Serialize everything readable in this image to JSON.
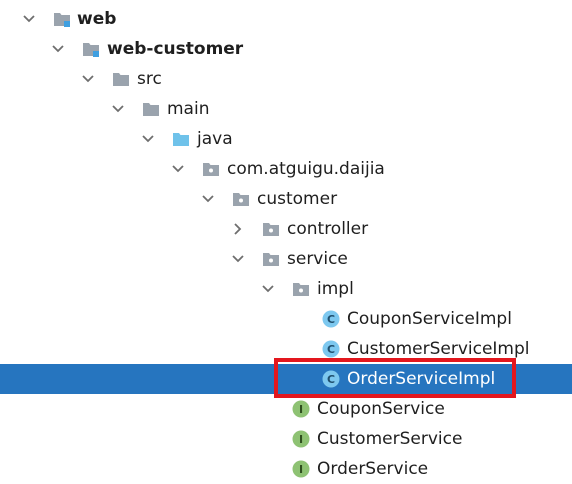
{
  "tree": {
    "nodes": [
      {
        "label": "web",
        "icon": "module-folder-icon",
        "expanded": true
      },
      {
        "label": "web-customer",
        "icon": "module-folder-icon",
        "expanded": true
      },
      {
        "label": "src",
        "icon": "folder-icon",
        "expanded": true
      },
      {
        "label": "main",
        "icon": "folder-icon",
        "expanded": true
      },
      {
        "label": "java",
        "icon": "source-root-folder-icon",
        "expanded": true
      },
      {
        "label": "com.atguigu.daijia",
        "icon": "package-icon",
        "expanded": true
      },
      {
        "label": "customer",
        "icon": "package-icon",
        "expanded": true
      },
      {
        "label": "controller",
        "icon": "package-icon",
        "expanded": false
      },
      {
        "label": "service",
        "icon": "package-icon",
        "expanded": true
      },
      {
        "label": "impl",
        "icon": "package-icon",
        "expanded": true
      },
      {
        "label": "CouponServiceImpl",
        "icon": "java-class-icon"
      },
      {
        "label": "CustomerServiceImpl",
        "icon": "java-class-icon"
      },
      {
        "label": "OrderServiceImpl",
        "icon": "java-class-icon",
        "selected": true
      },
      {
        "label": "CouponService",
        "icon": "java-interface-icon"
      },
      {
        "label": "CustomerService",
        "icon": "java-interface-icon"
      },
      {
        "label": "OrderService",
        "icon": "java-interface-icon"
      }
    ]
  },
  "colors": {
    "selection": "#2675bf",
    "highlight_border": "#e3171e",
    "class_icon": "#7dc8ef",
    "interface_icon": "#8ec273",
    "folder": "#9aa3ad",
    "source_root": "#6fc2ea"
  }
}
